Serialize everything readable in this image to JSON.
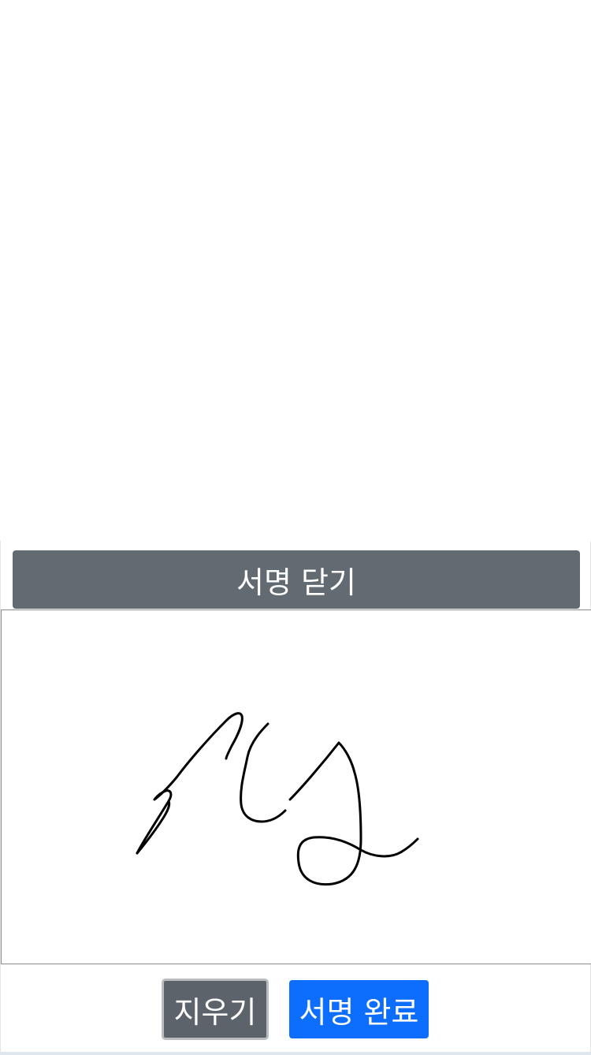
{
  "signature_panel": {
    "close_label": "서명 닫기",
    "clear_label": "지우기",
    "complete_label": "서명 완료"
  }
}
